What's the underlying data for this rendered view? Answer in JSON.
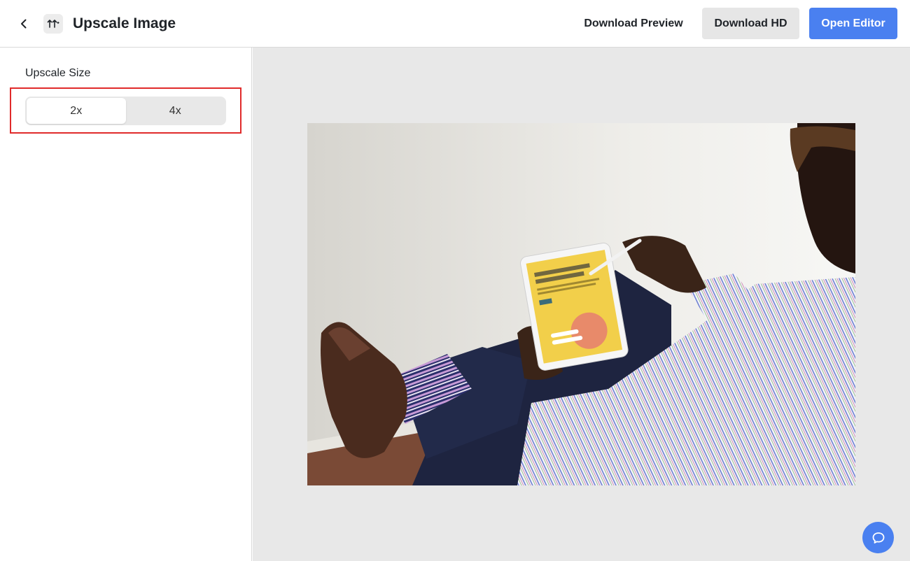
{
  "header": {
    "title": "Upscale Image",
    "back_icon": "chevron-left-icon",
    "tool_icon": "upscale-icon",
    "download_preview_label": "Download Preview",
    "download_hd_label": "Download HD",
    "open_editor_label": "Open Editor"
  },
  "sidebar": {
    "upscale_size_label": "Upscale Size",
    "options": [
      {
        "label": "2x",
        "selected": true
      },
      {
        "label": "4x",
        "selected": false
      }
    ]
  },
  "canvas": {
    "image_subject": "person-using-tablet-photo"
  },
  "chat_icon": "chat-bubble-icon",
  "colors": {
    "accent": "#4a80f0",
    "highlight": "#e02b2b",
    "canvas_bg": "#e8e8e8"
  }
}
